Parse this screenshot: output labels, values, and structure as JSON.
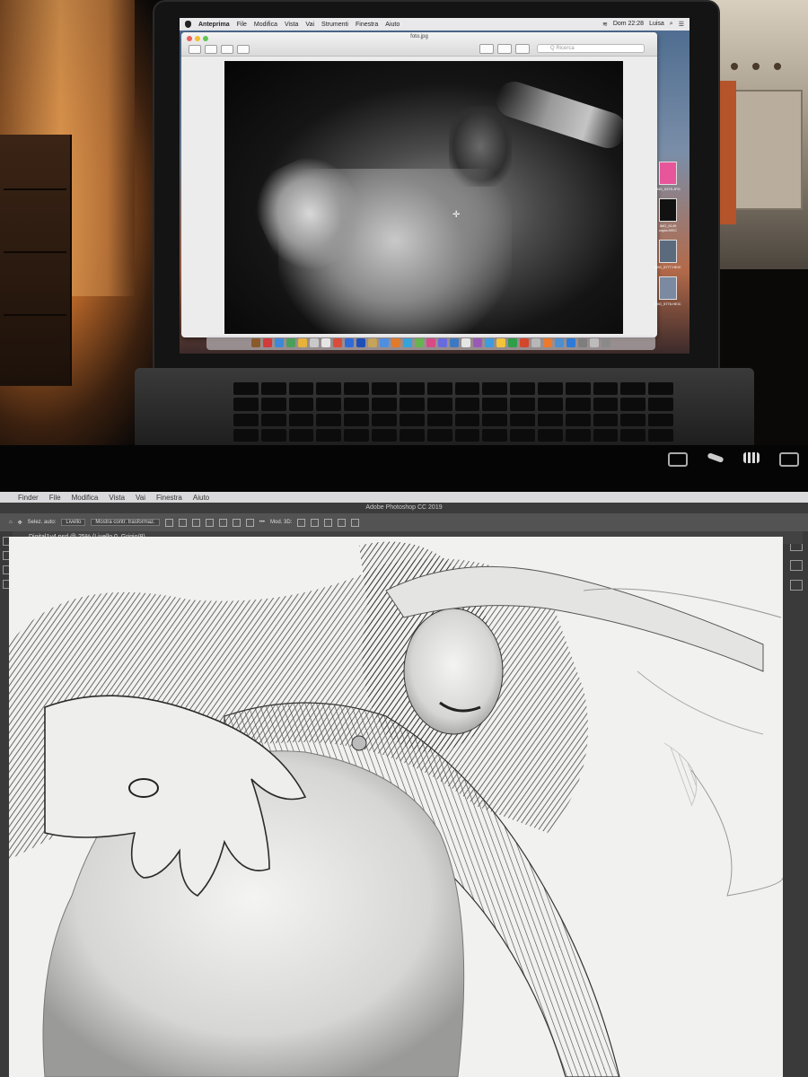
{
  "laptop": {
    "menubar": {
      "app_name": "Anteprima",
      "menus": [
        "File",
        "Modifica",
        "Vista",
        "Vai",
        "Strumenti",
        "Finestra",
        "Aiuto"
      ],
      "clock": "Dom 22:28",
      "user": "Luisa"
    },
    "preview": {
      "filename": "foto.jpg",
      "search_placeholder": "Q Ricerca"
    },
    "desktop_files": [
      {
        "label": "IMG_5375.JPG",
        "color": "#e7559a"
      },
      {
        "label": "IMG_6149 copia.HEIC",
        "color": "#111111"
      },
      {
        "label": "IMG_5777.HEIC",
        "color": "#5c6a7e"
      },
      {
        "label": "IMG_5776.HEIC",
        "color": "#7b8aa0"
      }
    ],
    "dock_colors": [
      "#8a5a2b",
      "#d33a3a",
      "#3e88d8",
      "#4aa05a",
      "#e6b23a",
      "#c9c9c9",
      "#e5e5e5",
      "#d94c3a",
      "#2f6bd8",
      "#1e4fb8",
      "#c4a35a",
      "#4f8fe0",
      "#e07b2c",
      "#36a3d9",
      "#66b34f",
      "#d84a86",
      "#6a6adf",
      "#3d79c2",
      "#e5e5e5",
      "#9b59b6",
      "#3d9be0",
      "#f3c43a",
      "#2e9e48",
      "#d4462c",
      "#b7b7b7",
      "#ea7a2d",
      "#4c8fcf",
      "#2d7ad8",
      "#7e7e7e",
      "#bcbcbc",
      "#8a8a8a"
    ]
  },
  "photoshop": {
    "menubar": [
      "Finder",
      "File",
      "Modifica",
      "Vista",
      "Vai",
      "Finestra",
      "Aiuto"
    ],
    "title": "Adobe Photoshop CC 2019",
    "options": {
      "auto_select": "Selez. auto:",
      "layer": "Livello",
      "transform": "Mostra contr. trasformaz.",
      "mode_3d": "Mod. 3D:"
    },
    "document_tab": "Digital1v4.psd @ 25% (Livello 0, Grigio/8)"
  }
}
